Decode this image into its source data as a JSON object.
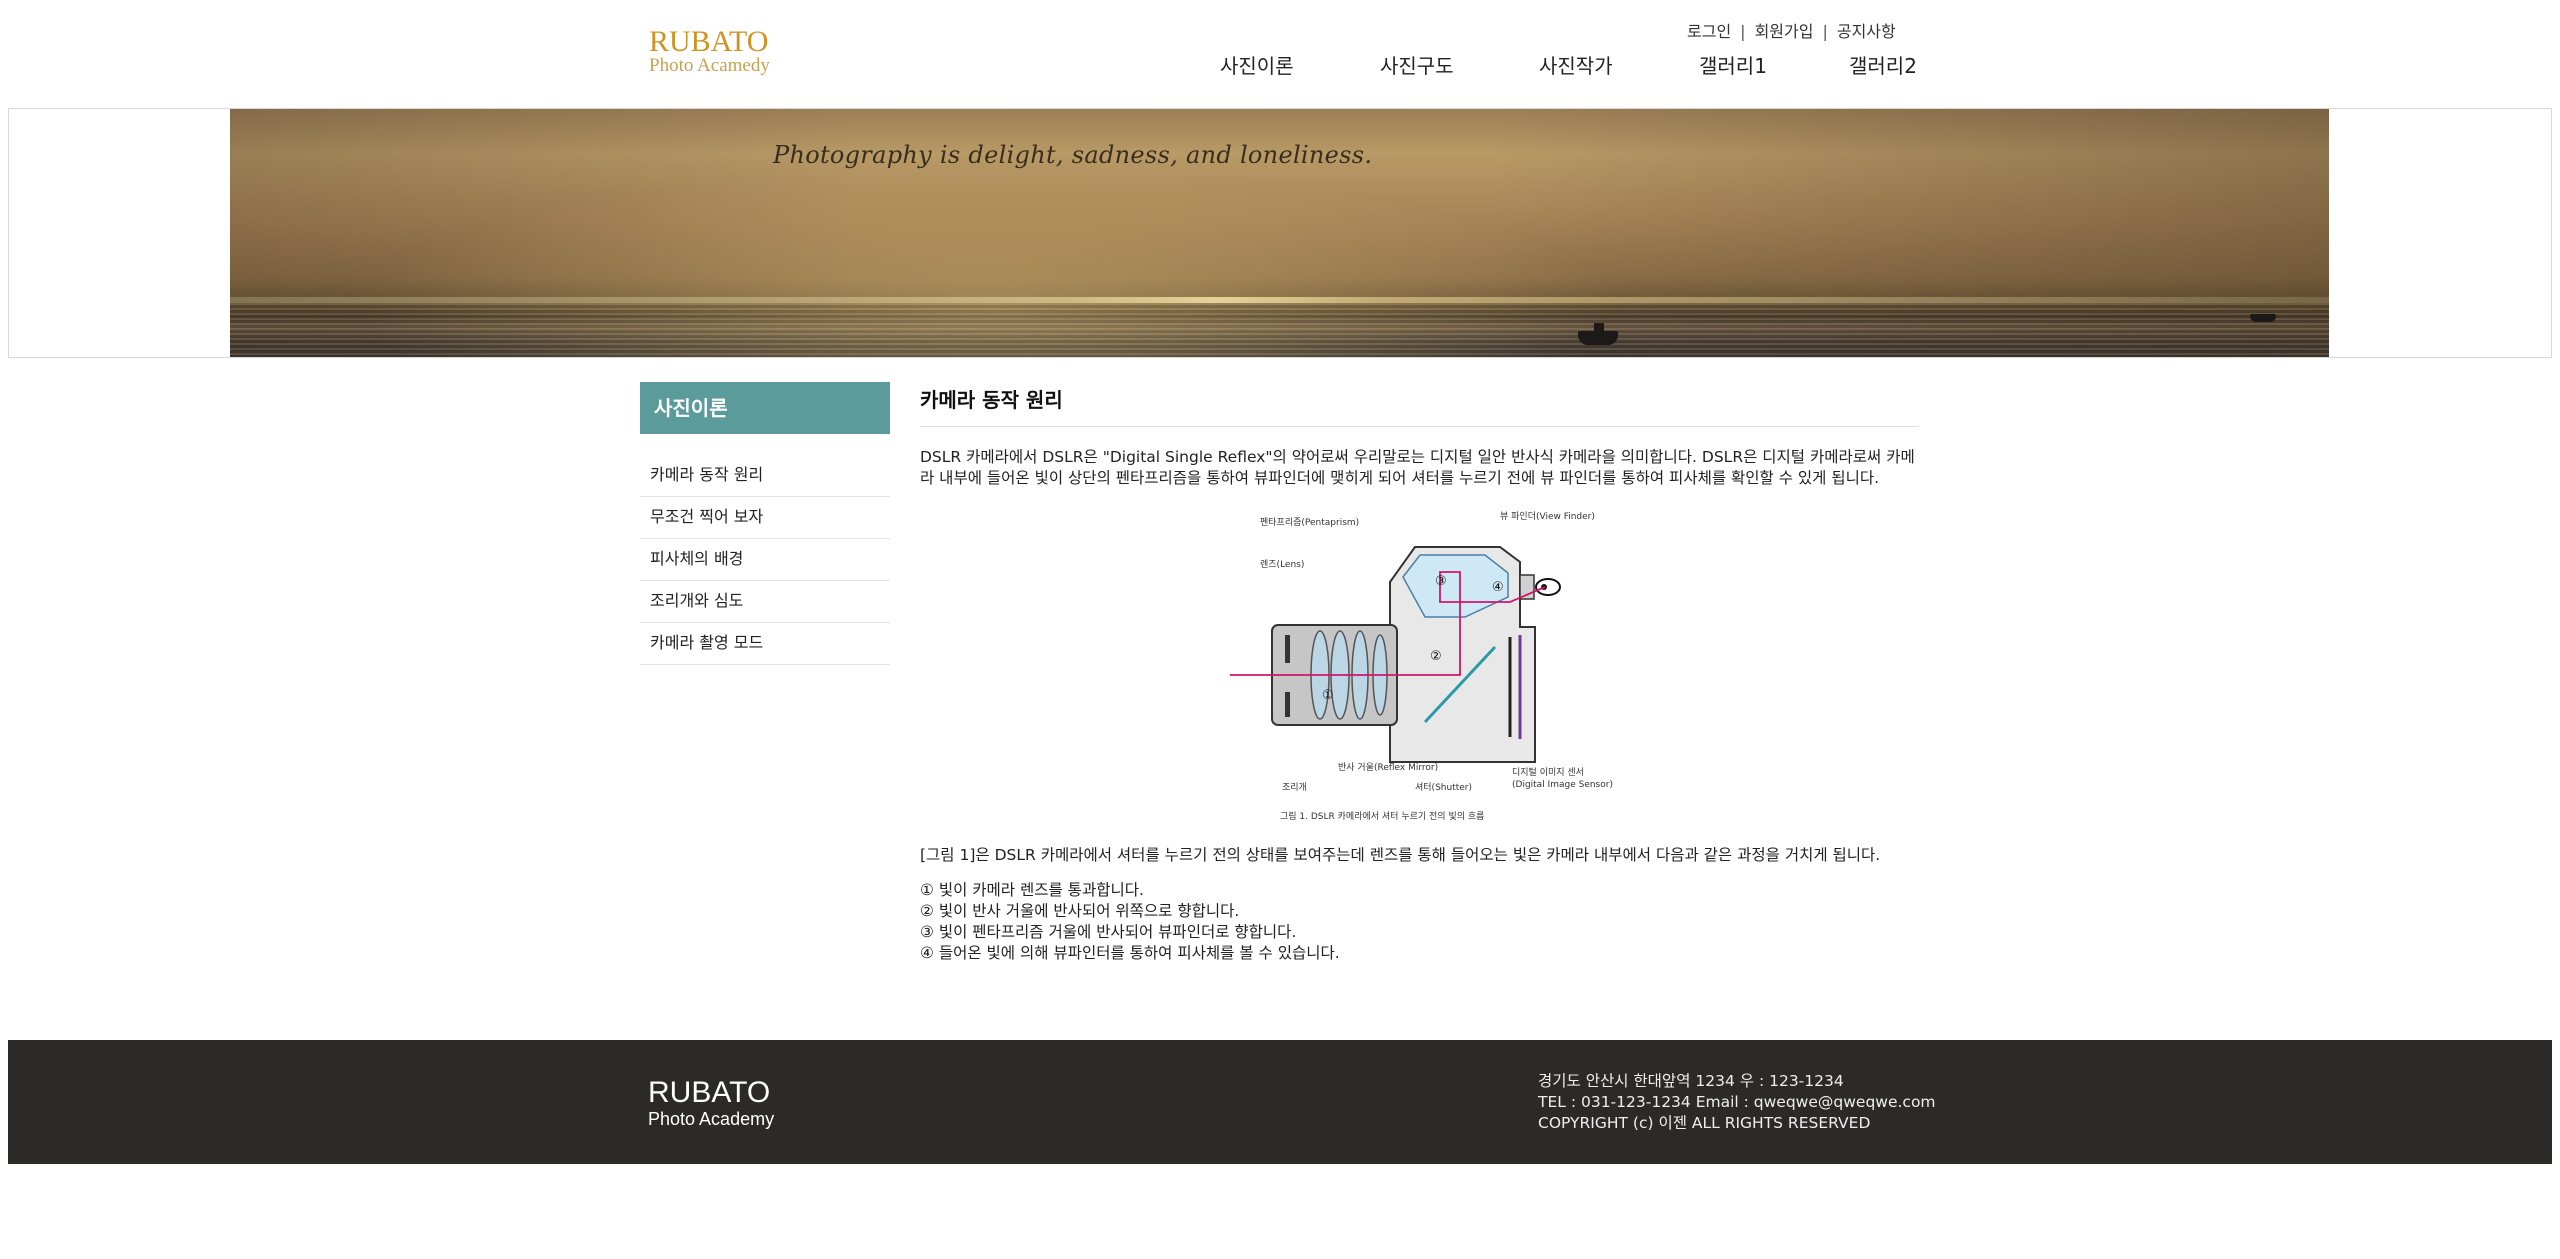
{
  "header": {
    "logo_line1": "RUBATO",
    "logo_line2": "Photo Acamedy",
    "util": [
      "로그인",
      "회원가입",
      "공지사항"
    ],
    "nav": [
      "사진이론",
      "사진구도",
      "사진작가",
      "갤러리1",
      "갤러리2"
    ]
  },
  "banner": {
    "quote": "Photography is delight, sadness, and loneliness."
  },
  "sidebar": {
    "title": "사진이론",
    "items": [
      "카메라 동작 원리",
      "무조건 찍어 보자",
      "피사체의 배경",
      "조리개와 심도",
      "카메라 촬영 모드"
    ]
  },
  "main": {
    "title": "카메라 동작 원리",
    "intro": "DSLR 카메라에서 DSLR은 \"Digital Single Reflex\"의 약어로써 우리말로는 디지털 일안 반사식 카메라을 의미합니다. DSLR은 디지털 카메라로써 카메라 내부에 들어온 빛이 상단의 펜타프리즘을 통하여 뷰파인더에 맺히게 되어 셔터를 누르기 전에 뷰 파인더를 통하여 피사체를 확인할 수 있게 됩니다.",
    "figure": {
      "label_pentaprism": "펜타프리즘(Pentaprism)",
      "label_viewfinder": "뷰 파인더(View Finder)",
      "label_lens": "렌즈(Lens)",
      "label_aperture": "조리개",
      "label_mirror": "반사 거울(Reflex Mirror)",
      "label_shutter": "셔터(Shutter)",
      "label_sensor1": "디지털 이미지 센서",
      "label_sensor2": "(Digital Image Sensor)",
      "caption": "그림 1. DSLR 카메라에서 셔터 누르기 전의 빛의 흐름",
      "n1": "①",
      "n2": "②",
      "n3": "③",
      "n4": "④"
    },
    "explain": "[그림 1]은 DSLR 카메라에서 셔터를 누르기 전의 상태를 보여주는데 렌즈를 통해 들어오는 빛은 카메라 내부에서 다음과 같은 과정을 거치게 됩니다.",
    "steps": [
      "① 빛이 카메라 렌즈를 통과합니다.",
      "② 빛이 반사 거울에 반사되어 위쪽으로 향합니다.",
      "③ 빛이 펜타프리즘 거울에 반사되어 뷰파인더로 향합니다.",
      "④ 들어온 빛에 의해 뷰파인터를 통하여 피사체를 볼 수 있습니다."
    ]
  },
  "footer": {
    "logo_line1": "RUBATO",
    "logo_line2": "Photo Academy",
    "address": "경기도 안산시 한대앞역 1234 우 : 123-1234",
    "contact": "TEL : 031-123-1234 Email : qweqwe@qweqwe.com",
    "copyright": "COPYRIGHT (c) 이젠 ALL RIGHTS RESERVED"
  },
  "colors": {
    "logo": "#d09322",
    "sidebar_title_bg": "#5b9b9b",
    "footer_bg": "#2b2a29"
  }
}
